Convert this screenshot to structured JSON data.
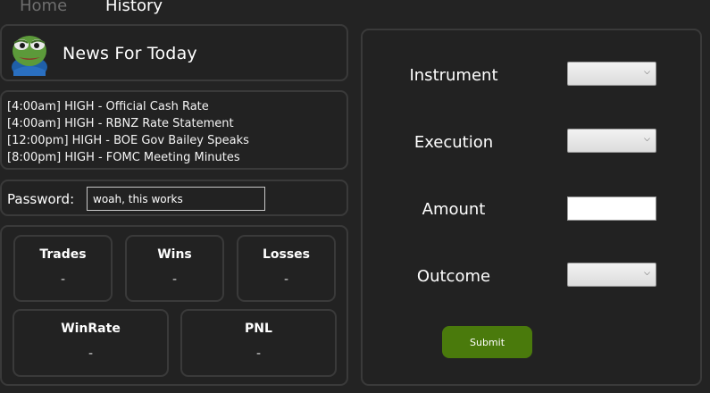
{
  "nav": {
    "tabs": [
      {
        "label": "Home",
        "active": false
      },
      {
        "label": "History",
        "active": true
      }
    ]
  },
  "news": {
    "logo_icon": "pepe-frog-icon",
    "title": "News For Today",
    "items": [
      "[4:00am] HIGH - Official Cash Rate",
      "[4:00am] HIGH - RBNZ Rate Statement",
      "[12:00pm] HIGH - BOE Gov Bailey Speaks",
      "[8:00pm] HIGH - FOMC Meeting Minutes"
    ]
  },
  "password": {
    "label": "Password:",
    "value": "woah, this works"
  },
  "stats": {
    "trades": {
      "label": "Trades",
      "value": "-"
    },
    "wins": {
      "label": "Wins",
      "value": "-"
    },
    "losses": {
      "label": "Losses",
      "value": "-"
    },
    "winrate": {
      "label": "WinRate",
      "value": "-"
    },
    "pnl": {
      "label": "PNL",
      "value": "-"
    }
  },
  "form": {
    "instrument_label": "Instrument",
    "execution_label": "Execution",
    "amount_label": "Amount",
    "outcome_label": "Outcome",
    "instrument_value": "",
    "execution_value": "",
    "amount_value": "",
    "outcome_value": "",
    "submit_label": "Submit"
  },
  "colors": {
    "background": "#232323",
    "card_border": "#3a3a3a",
    "submit_button": "#4a7a0c",
    "inactive_tab": "#6e6e6e"
  }
}
